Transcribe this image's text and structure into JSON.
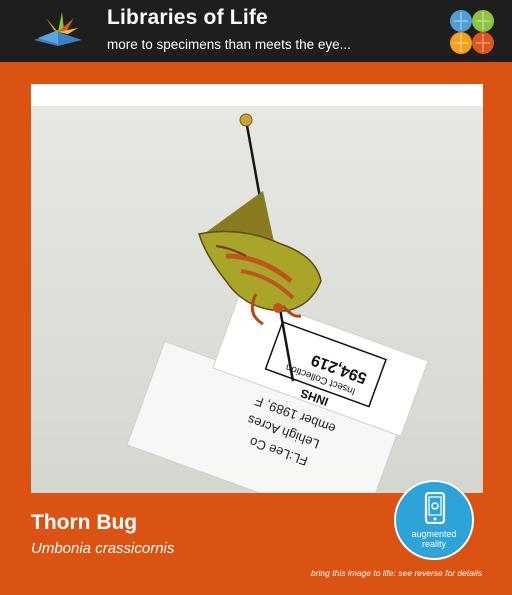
{
  "header": {
    "title": "Libraries of Life",
    "tagline": "more to specimens than meets the eye..."
  },
  "specimen": {
    "common_name": "Thorn Bug",
    "scientific_name": "Umbonia crassicornis"
  },
  "badge": {
    "line1": "augmented",
    "line2": "reality"
  },
  "footer": {
    "note": "bring this image to life: see reverse for details"
  },
  "photo_labels": {
    "label1_line1": "INHS",
    "label1_line2": "594,219",
    "label1_line3": "Insect Collection",
    "label2_line1": "ember 1989, F",
    "label2_line2": "Lehigh Acres",
    "label2_line3": "FL:Lee Co"
  },
  "colors": {
    "card_orange": "#db5312",
    "header_dark": "#1e1e1e",
    "badge_blue": "#2ea3d8"
  }
}
